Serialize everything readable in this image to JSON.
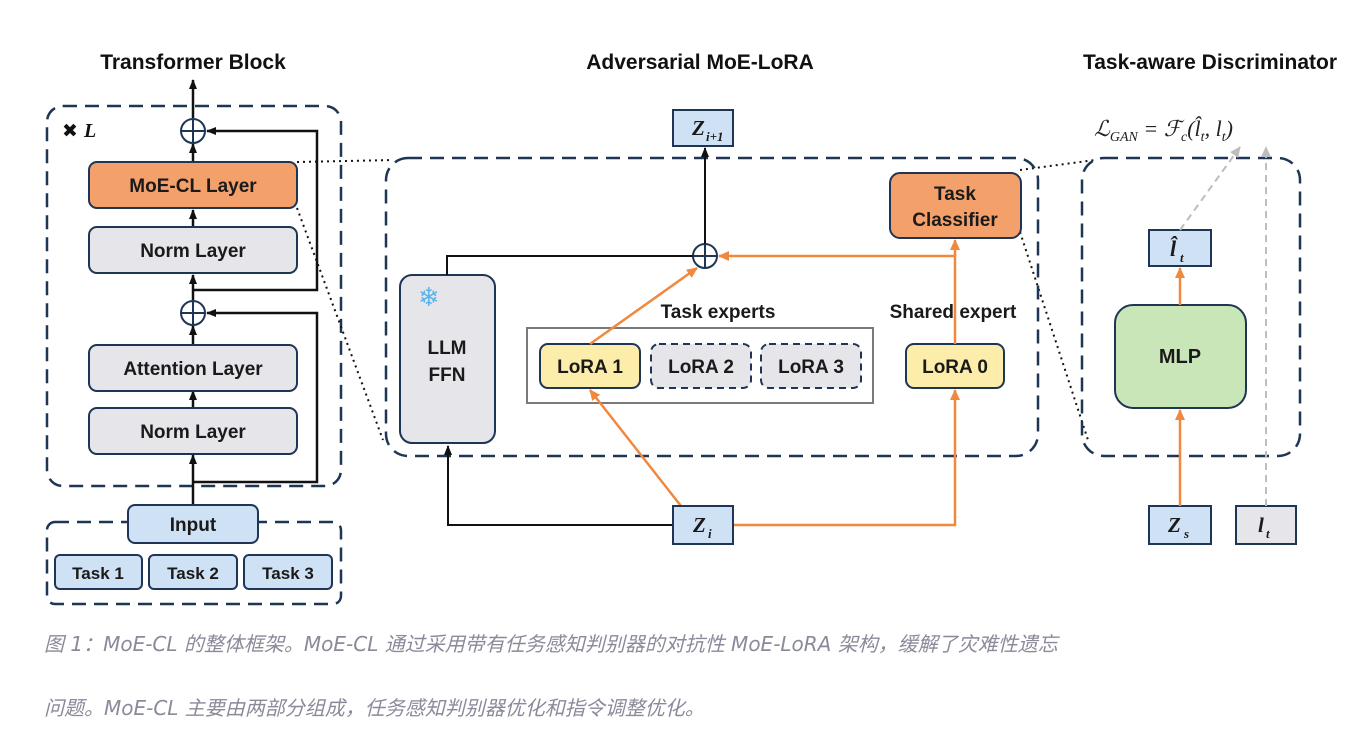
{
  "titles": {
    "transformer_block": "Transformer Block",
    "adversarial_moe_lora": "Adversarial MoE-LoRA",
    "task_aware_discriminator": "Task-aware Discriminator"
  },
  "transformer": {
    "repeat_mark": "✖",
    "repeat_label": "L",
    "moe_cl_layer": "MoE-CL Layer",
    "norm_layer_top": "Norm Layer",
    "attention_layer": "Attention Layer",
    "norm_layer_bottom": "Norm Layer",
    "input": "Input",
    "tasks": [
      "Task 1",
      "Task 2",
      "Task 3"
    ]
  },
  "moe_lora": {
    "z_out": "Z",
    "z_out_sub": "i+1",
    "z_in": "Z",
    "z_in_sub": "i",
    "snowflake": "❄",
    "llm_ffn_line1": "LLM",
    "llm_ffn_line2": "FFN",
    "task_experts": "Task experts",
    "shared_expert": "Shared expert",
    "lora1": "LoRA 1",
    "lora2": "LoRA 2",
    "lora3": "LoRA 3",
    "lora0": "LoRA 0",
    "task_classifier_line1": "Task",
    "task_classifier_line2": "Classifier"
  },
  "discriminator": {
    "loss": "ℒ",
    "loss_sub": "GAN",
    "loss_eq": " = ℱ",
    "loss_fsub": "c",
    "loss_args": "(l̂",
    "loss_args_sub1": "t",
    "loss_args_mid": ", l",
    "loss_args_sub2": "t",
    "loss_close": ")",
    "l_hat": "l̂",
    "l_hat_sub": "t",
    "mlp": "MLP",
    "z_s": "Z",
    "z_s_sub": "s",
    "l_t": "l",
    "l_t_sub": "t"
  },
  "caption": {
    "line1": "图 1：MoE-CL 的整体框架。MoE-CL 通过采用带有任务感知判别器的对抗性 MoE-LoRA 架构，缓解了灾难性遗忘",
    "line2": "问题。MoE-CL 主要由两部分组成，任务感知判别器优化和指令调整优化。"
  },
  "colors": {
    "orange": "#f4a06b",
    "orange_arrow": "#f0883e",
    "gray_box": "#e6e6ea",
    "yellow_box": "#fdedaa",
    "blue_box": "#cfe2f5",
    "green_box": "#c8e6b8",
    "navy_border": "#1f3556"
  }
}
